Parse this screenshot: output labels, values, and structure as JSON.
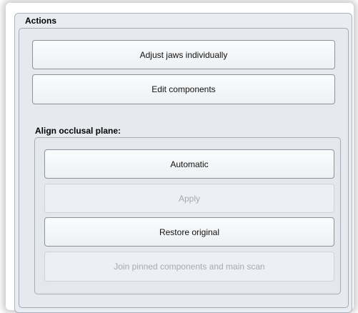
{
  "panel": {
    "title": "Actions"
  },
  "buttons": {
    "adjust_jaws": "Adjust jaws individually",
    "edit_components": "Edit components"
  },
  "align_section": {
    "title": "Align occlusal plane:",
    "automatic": "Automatic",
    "apply": "Apply",
    "restore_original": "Restore original",
    "join_pinned": "Join pinned components and main scan"
  }
}
